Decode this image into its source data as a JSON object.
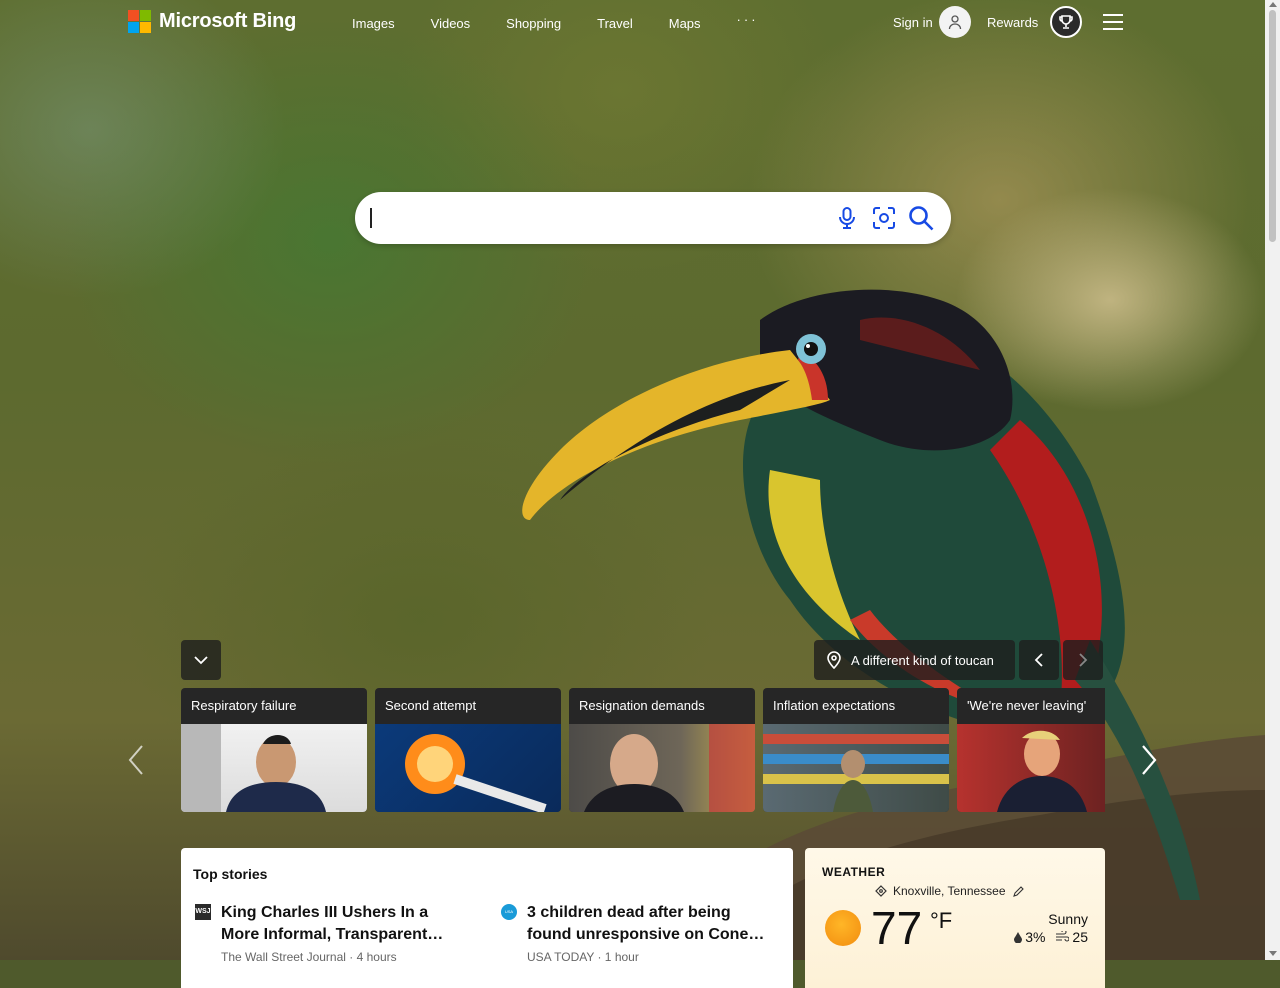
{
  "brand": {
    "name": "Microsoft Bing",
    "logo_colors": [
      "#f25022",
      "#7fba00",
      "#00a4ef",
      "#ffb900"
    ]
  },
  "nav": {
    "items": [
      "Images",
      "Videos",
      "Shopping",
      "Travel",
      "Maps"
    ],
    "more_label": "···"
  },
  "account": {
    "signin_label": "Sign in",
    "rewards_label": "Rewards",
    "avatar_icon": "person-icon",
    "rewards_icon": "trophy-icon"
  },
  "search": {
    "value": "",
    "placeholder": "",
    "voice_icon": "microphone-icon",
    "visual_icon": "visual-search-icon",
    "search_icon": "search-icon",
    "accent": "#174ae4"
  },
  "image_of_day": {
    "caption": "A different kind of toucan"
  },
  "news_cards": [
    {
      "title": "Respiratory failure"
    },
    {
      "title": "Second attempt"
    },
    {
      "title": "Resignation demands"
    },
    {
      "title": "Inflation expectations"
    },
    {
      "title": "'We're never leaving'"
    }
  ],
  "top_stories": {
    "heading": "Top stories",
    "items": [
      {
        "source_badge": "WSJ",
        "headline": "King Charles III Ushers In a More Informal, Transparent…",
        "meta": "The Wall Street Journal · 4 hours"
      },
      {
        "source_badge": "USA TODAY",
        "headline": "3 children dead after being found unresponsive on Cone…",
        "meta": "USA TODAY · 1 hour"
      }
    ]
  },
  "weather": {
    "label": "WEATHER",
    "location": "Knoxville, Tennessee",
    "temp": "77",
    "unit": "°F",
    "condition": "Sunny",
    "precip": "3%",
    "aqi": "25"
  }
}
